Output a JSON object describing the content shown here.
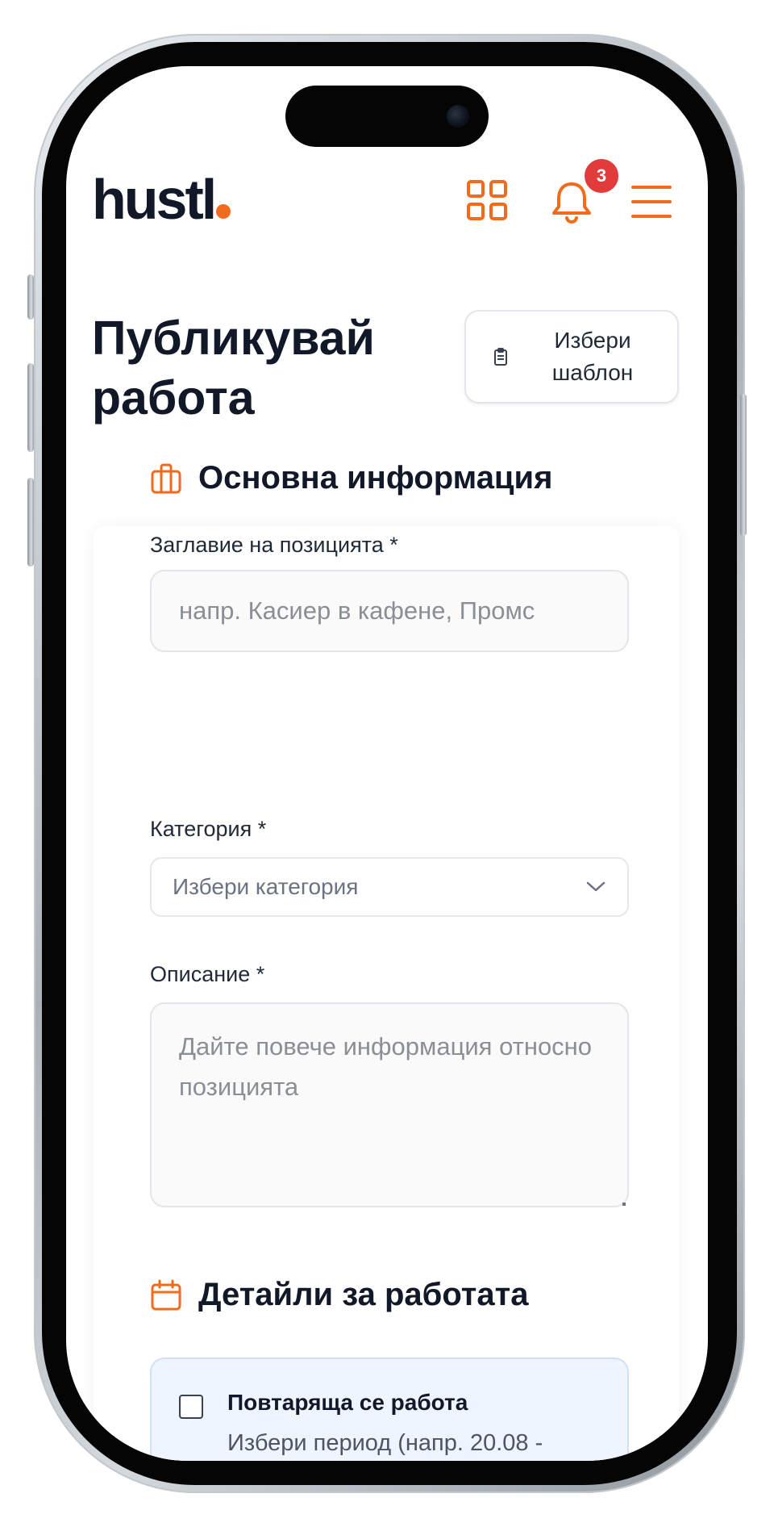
{
  "header": {
    "logo_text": "hustl",
    "notification_count": "3",
    "icons": [
      "grid-icon",
      "bell-icon",
      "hamburger-menu-icon"
    ]
  },
  "page": {
    "title": "Публикувай работа",
    "template_button": "Избери шаблон"
  },
  "basic_info": {
    "heading": "Основна информация",
    "title_label": "Заглавие на позицията *",
    "title_placeholder": "напр. Касиер в кафене, Промс",
    "category_label": "Категория *",
    "category_value": "Избери категория",
    "description_label": "Описание *",
    "description_placeholder": "Дайте повече информация относно позицията"
  },
  "job_details": {
    "heading": "Детайли за работата",
    "recurring_title": "Повтаряща се работа",
    "recurring_desc": "Избери период (напр. 20.08 -"
  },
  "colors": {
    "accent": "#f26b1d",
    "badge": "#e23b3b",
    "text": "#111827",
    "recurring_bg": "#eef5fe"
  }
}
